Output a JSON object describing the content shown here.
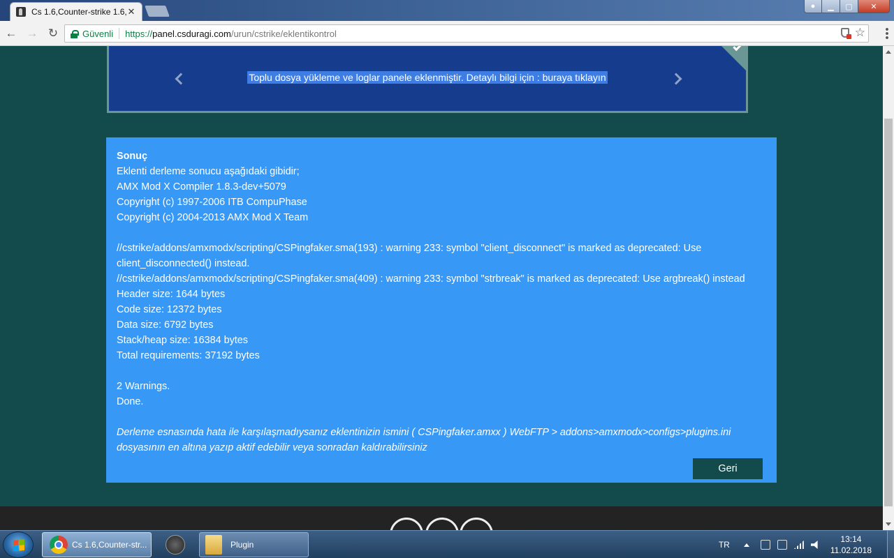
{
  "browser": {
    "tab_title": "Cs 1.6,Counter-strike 1.6,",
    "tab_close": "✕",
    "secure_label": "Güvenli",
    "url_scheme": "https://",
    "url_host": "panel.csduragi.com",
    "url_path": "/urun/cstrike/eklentikontrol",
    "back_icon": "arrow-left-icon",
    "forward_icon": "arrow-right-icon",
    "reload_icon": "reload-icon"
  },
  "announcement": {
    "text": "Toplu dosya yükleme ve loglar panele eklenmiştir. Detaylı bilgi için : buraya tıklayın"
  },
  "result": {
    "heading": "Sonuç",
    "intro": "Eklenti derleme sonucu aşağıdaki gibidir;",
    "compiler": "AMX Mod X Compiler 1.8.3-dev+5079",
    "copyright1": "Copyright (c) 1997-2006 ITB CompuPhase",
    "copyright2": "Copyright (c) 2004-2013 AMX Mod X Team",
    "warning1": "//cstrike/addons/amxmodx/scripting/CSPingfaker.sma(193) : warning 233: symbol \"client_disconnect\" is marked as deprecated: Use client_disconnected() instead.",
    "warning2": "//cstrike/addons/amxmodx/scripting/CSPingfaker.sma(409) : warning 233: symbol \"strbreak\" is marked as deprecated: Use argbreak() instead",
    "header_size": "Header size: 1644 bytes",
    "code_size": "Code size: 12372 bytes",
    "data_size": "Data size: 6792 bytes",
    "stack_size": "Stack/heap size: 16384 bytes",
    "total": "Total requirements: 37192 bytes",
    "warnings": "2 Warnings.",
    "done": "Done.",
    "note": "Derleme esnasında hata ile karşılaşmadıysanız eklentinizin ismini ( CSPingfaker.amxx ) WebFTP > addons>amxmodx>configs>plugins.ini dosyasının en altına yazıp aktif edebilir veya sonradan kaldırabilirsiniz",
    "back_button": "Geri"
  },
  "taskbar": {
    "chrome_task": "Cs 1.6,Counter-str...",
    "folder_task": "Plugin",
    "language": "TR",
    "time": "13:14",
    "date": "11.02.2018"
  }
}
